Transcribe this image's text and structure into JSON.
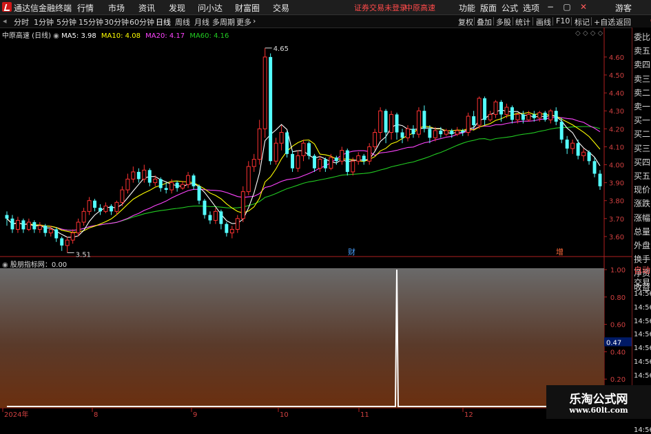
{
  "titlebar": {
    "app_title": "通达信金融终端",
    "menus": [
      "行情",
      "市场",
      "资讯",
      "发现",
      "问小达",
      "财富圈",
      "交易"
    ],
    "warning": "证券交易未登录",
    "stock_name": "中原高速",
    "right_menus": [
      "功能",
      "版面",
      "公式",
      "选项"
    ],
    "user": "游客"
  },
  "toolbar": {
    "periods": [
      "分时",
      "1分钟",
      "5分钟",
      "15分钟",
      "30分钟",
      "60分钟",
      "日线",
      "周线",
      "月线",
      "多周期",
      "更多"
    ],
    "active_period": "日线",
    "right_buttons": [
      "复权",
      "叠加",
      "多股",
      "统计",
      "画线",
      "F10",
      "标记",
      "+自选",
      "返回"
    ]
  },
  "legend": {
    "title": "中原高速 (日线)",
    "ma": [
      {
        "label": "MA5: 3.98",
        "color": "#ffffff"
      },
      {
        "label": "MA10: 4.08",
        "color": "#ffff00"
      },
      {
        "label": "MA20: 4.17",
        "color": "#ff44ff"
      },
      {
        "label": "MA60: 4.16",
        "color": "#22cc22"
      }
    ]
  },
  "indicator": {
    "label": "股朋指标网：0.00",
    "value_box": "0.47"
  },
  "colors": {
    "up": "#ff3232",
    "down": "#54ffff",
    "ma5": "#ffffff",
    "ma10": "#ffff00",
    "ma20": "#ff44ff",
    "ma60": "#22cc22",
    "axis": "#b02020"
  },
  "price_axis": [
    "4.60",
    "4.50",
    "4.40",
    "4.30",
    "4.20",
    "4.10",
    "4.00",
    "3.90",
    "3.80",
    "3.70",
    "3.60"
  ],
  "indicator_axis": [
    "1.00",
    "0.80",
    "0.60",
    "0.40",
    "0.20"
  ],
  "date_axis": [
    "2024年",
    "8",
    "9",
    "10",
    "11",
    "12"
  ],
  "annotations": {
    "high": "4.65",
    "low": "3.51",
    "mark_cai": "财",
    "mark_zeng": "增"
  },
  "right_panel": {
    "labels": [
      "委比",
      "卖五",
      "卖四",
      "卖三",
      "卖二",
      "卖一",
      "买一",
      "买二",
      "买三",
      "买四",
      "买五",
      "现价",
      "涨跌",
      "涨幅",
      "总量",
      "外盘",
      "换手",
      "净资",
      "收益"
    ],
    "trade_labels": [
      "自动",
      "交易"
    ],
    "times": [
      "14:56",
      "14:56",
      "14:56",
      "14:56",
      "14:56",
      "14:56",
      "14:56",
      "14:56",
      "14:56",
      "14:56",
      "14:56"
    ],
    "corner_top": "0.",
    "corner_bottom": "100"
  },
  "chart_data": {
    "type": "candlestick",
    "y_range": [
      3.5,
      4.68
    ],
    "candles": [
      [
        3.72,
        3.7,
        3.74,
        3.66
      ],
      [
        3.7,
        3.64,
        3.72,
        3.62
      ],
      [
        3.64,
        3.69,
        3.71,
        3.62
      ],
      [
        3.69,
        3.64,
        3.7,
        3.62
      ],
      [
        3.64,
        3.68,
        3.7,
        3.63
      ],
      [
        3.68,
        3.64,
        3.69,
        3.62
      ],
      [
        3.64,
        3.66,
        3.68,
        3.62
      ],
      [
        3.66,
        3.62,
        3.67,
        3.6
      ],
      [
        3.62,
        3.64,
        3.66,
        3.6
      ],
      [
        3.64,
        3.59,
        3.65,
        3.57
      ],
      [
        3.59,
        3.55,
        3.6,
        3.52
      ],
      [
        3.55,
        3.58,
        3.6,
        3.51
      ],
      [
        3.58,
        3.62,
        3.64,
        3.56
      ],
      [
        3.62,
        3.68,
        3.7,
        3.6
      ],
      [
        3.68,
        3.74,
        3.76,
        3.66
      ],
      [
        3.74,
        3.8,
        3.82,
        3.72
      ],
      [
        3.8,
        3.76,
        3.81,
        3.74
      ],
      [
        3.76,
        3.74,
        3.78,
        3.72
      ],
      [
        3.74,
        3.77,
        3.79,
        3.73
      ],
      [
        3.77,
        3.74,
        3.78,
        3.72
      ],
      [
        3.74,
        3.79,
        3.8,
        3.72
      ],
      [
        3.79,
        3.86,
        3.88,
        3.77
      ],
      [
        3.86,
        3.92,
        3.95,
        3.84
      ],
      [
        3.92,
        3.96,
        3.99,
        3.9
      ],
      [
        3.96,
        3.92,
        3.98,
        3.9
      ],
      [
        3.92,
        3.97,
        4.0,
        3.9
      ],
      [
        3.97,
        3.9,
        3.98,
        3.88
      ],
      [
        3.9,
        3.92,
        3.94,
        3.88
      ],
      [
        3.92,
        3.87,
        3.93,
        3.85
      ],
      [
        3.87,
        3.86,
        3.9,
        3.84
      ],
      [
        3.86,
        3.9,
        3.92,
        3.84
      ],
      [
        3.9,
        3.87,
        3.91,
        3.85
      ],
      [
        3.87,
        3.89,
        3.91,
        3.86
      ],
      [
        3.89,
        3.94,
        3.96,
        3.87
      ],
      [
        3.94,
        3.88,
        3.95,
        3.86
      ],
      [
        3.88,
        3.8,
        3.89,
        3.78
      ],
      [
        3.8,
        3.72,
        3.81,
        3.7
      ],
      [
        3.72,
        3.69,
        3.74,
        3.67
      ],
      [
        3.69,
        3.74,
        3.76,
        3.67
      ],
      [
        3.74,
        3.67,
        3.75,
        3.64
      ],
      [
        3.67,
        3.62,
        3.68,
        3.6
      ],
      [
        3.62,
        3.64,
        3.66,
        3.59
      ],
      [
        3.64,
        3.7,
        3.72,
        3.62
      ],
      [
        3.7,
        3.85,
        3.88,
        3.68
      ],
      [
        3.85,
        3.99,
        4.02,
        3.83
      ],
      [
        3.99,
        4.03,
        4.06,
        3.96
      ],
      [
        4.03,
        4.2,
        4.25,
        4.0
      ],
      [
        4.2,
        4.6,
        4.65,
        4.15
      ],
      [
        4.6,
        4.02,
        4.62,
        4.0
      ],
      [
        4.02,
        4.12,
        4.15,
        4.0
      ],
      [
        4.12,
        4.18,
        4.22,
        4.08
      ],
      [
        4.18,
        4.06,
        4.19,
        4.04
      ],
      [
        4.06,
        3.98,
        4.08,
        3.96
      ],
      [
        3.98,
        4.05,
        4.08,
        3.96
      ],
      [
        4.05,
        4.12,
        4.14,
        4.02
      ],
      [
        4.12,
        4.05,
        4.13,
        4.03
      ],
      [
        4.05,
        3.98,
        4.06,
        3.96
      ],
      [
        3.98,
        4.03,
        4.05,
        3.96
      ],
      [
        4.03,
        3.98,
        4.04,
        3.96
      ],
      [
        3.98,
        4.04,
        4.06,
        3.97
      ],
      [
        4.04,
        4.02,
        4.05,
        4.0
      ],
      [
        4.02,
        4.08,
        4.1,
        4.0
      ],
      [
        4.08,
        3.96,
        4.09,
        3.94
      ],
      [
        3.96,
        4.02,
        4.04,
        3.94
      ],
      [
        4.02,
        4.05,
        4.07,
        4.0
      ],
      [
        4.05,
        4.02,
        4.06,
        4.0
      ],
      [
        4.02,
        4.1,
        4.12,
        4.0
      ],
      [
        4.1,
        4.18,
        4.2,
        4.08
      ],
      [
        4.18,
        4.3,
        4.32,
        4.14
      ],
      [
        4.3,
        4.18,
        4.31,
        4.12
      ],
      [
        4.18,
        4.28,
        4.3,
        4.14
      ],
      [
        4.28,
        4.18,
        4.29,
        4.14
      ],
      [
        4.18,
        4.15,
        4.2,
        4.12
      ],
      [
        4.15,
        4.2,
        4.22,
        4.13
      ],
      [
        4.2,
        4.17,
        4.22,
        4.15
      ],
      [
        4.17,
        4.3,
        4.32,
        4.15
      ],
      [
        4.3,
        4.2,
        4.33,
        4.18
      ],
      [
        4.2,
        4.15,
        4.22,
        4.12
      ],
      [
        4.15,
        4.19,
        4.21,
        4.13
      ],
      [
        4.19,
        4.17,
        4.21,
        4.15
      ],
      [
        4.17,
        4.19,
        4.2,
        4.16
      ],
      [
        4.19,
        4.17,
        4.2,
        4.15
      ],
      [
        4.17,
        4.19,
        4.21,
        4.16
      ],
      [
        4.19,
        4.18,
        4.2,
        4.16
      ],
      [
        4.18,
        4.27,
        4.29,
        4.16
      ],
      [
        4.27,
        4.22,
        4.3,
        4.2
      ],
      [
        4.22,
        4.37,
        4.38,
        4.2
      ],
      [
        4.37,
        4.25,
        4.38,
        4.22
      ],
      [
        4.25,
        4.28,
        4.3,
        4.24
      ],
      [
        4.28,
        4.35,
        4.36,
        4.26
      ],
      [
        4.35,
        4.28,
        4.36,
        4.24
      ],
      [
        4.28,
        4.32,
        4.34,
        4.26
      ],
      [
        4.32,
        4.25,
        4.33,
        4.23
      ],
      [
        4.25,
        4.28,
        4.29,
        4.23
      ],
      [
        4.28,
        4.25,
        4.3,
        4.23
      ],
      [
        4.25,
        4.28,
        4.3,
        4.24
      ],
      [
        4.28,
        4.26,
        4.3,
        4.24
      ],
      [
        4.26,
        4.29,
        4.3,
        4.24
      ],
      [
        4.29,
        4.25,
        4.3,
        4.24
      ],
      [
        4.25,
        4.3,
        4.31,
        4.23
      ],
      [
        4.3,
        4.24,
        4.32,
        4.22
      ],
      [
        4.24,
        4.14,
        4.26,
        4.12
      ],
      [
        4.14,
        4.09,
        4.16,
        4.06
      ],
      [
        4.09,
        4.12,
        4.14,
        4.06
      ],
      [
        4.12,
        4.05,
        4.14,
        4.03
      ],
      [
        4.05,
        4.07,
        4.09,
        4.02
      ],
      [
        4.07,
        4.02,
        4.08,
        4.0
      ],
      [
        4.02,
        3.95,
        4.04,
        3.93
      ],
      [
        3.95,
        3.88,
        3.97,
        3.86
      ]
    ]
  },
  "indicator_data": {
    "type": "line",
    "spike_index": 71,
    "spike_value": 1.0,
    "baseline": 0.0
  }
}
